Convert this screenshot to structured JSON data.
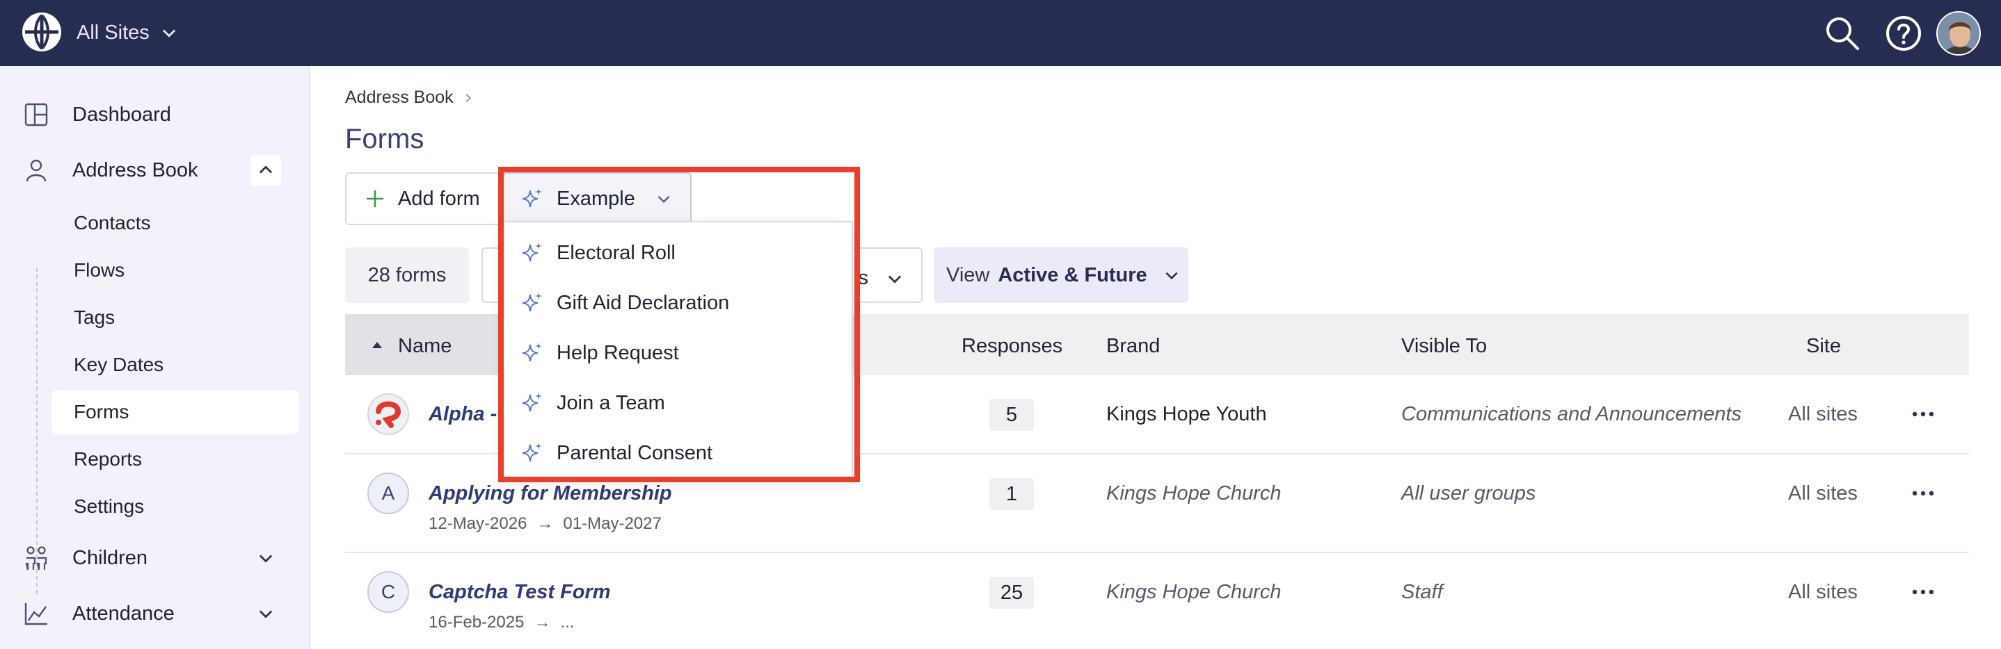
{
  "topbar": {
    "site_label": "All Sites",
    "bg_color": "#272c52",
    "icons": [
      "globe-logo-icon",
      "search-icon",
      "help-icon",
      "user-avatar"
    ]
  },
  "sidebar": {
    "items": [
      {
        "label": "Dashboard",
        "icon": "dashboard-icon"
      },
      {
        "label": "Address Book",
        "icon": "person-icon",
        "expanded": true
      },
      {
        "label": "Children",
        "icon": "children-icon"
      },
      {
        "label": "Attendance",
        "icon": "chart-icon"
      }
    ],
    "sub_items": [
      "Contacts",
      "Flows",
      "Tags",
      "Key Dates",
      "Forms",
      "Reports",
      "Settings"
    ],
    "active_sub_item": "Forms"
  },
  "breadcrumb": [
    "Address Book"
  ],
  "page_title": "Forms",
  "toolbar": {
    "add_label": "Add form",
    "example_label": "Example"
  },
  "filters": {
    "count_label": "28 forms",
    "filter_tail": "s",
    "view_label": "View",
    "view_value": "Active & Future"
  },
  "table": {
    "headers": {
      "name": "Name",
      "responses": "Responses",
      "brand": "Brand",
      "visible_to": "Visible To",
      "site": "Site"
    },
    "rows": [
      {
        "badge": "",
        "name": "Alpha - ",
        "start": "",
        "end": "",
        "responses": "5",
        "brand": "Kings Hope Youth",
        "visible_to": "Communications and Announcements",
        "site": "All sites"
      },
      {
        "badge": "A",
        "name": "Applying for Membership",
        "start": "12-May-2026",
        "arrow": "→",
        "end": "01-May-2027",
        "responses": "1",
        "brand": "Kings Hope Church",
        "visible_to": "All user groups",
        "site": "All sites"
      },
      {
        "badge": "C",
        "name": "Captcha Test Form",
        "start": "16-Feb-2025",
        "arrow": "→",
        "end": "...",
        "responses": "25",
        "brand": "Kings Hope Church",
        "visible_to": "Staff",
        "site": "All sites"
      }
    ]
  },
  "dropdown": {
    "items": [
      "Electoral Roll",
      "Gift Aid Declaration",
      "Help Request",
      "Join a Team",
      "Parental Consent"
    ],
    "highlight_color": "#e8402a"
  }
}
